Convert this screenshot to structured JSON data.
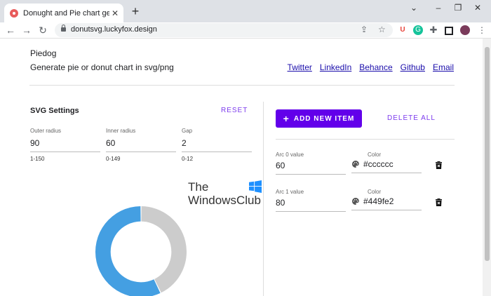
{
  "browser": {
    "tab_title": "Donught and Pie chart generator",
    "tab_close": "✕",
    "new_tab": "+",
    "url": "donutsvg.luckyfox.design",
    "window_controls": [
      "⌄",
      "–",
      "❐",
      "✕"
    ]
  },
  "header": {
    "brand": "Piedog",
    "tagline": "Generate pie or donut chart in svg/png",
    "links": [
      "Twitter",
      "LinkedIn",
      "Behance",
      "Github",
      "Email"
    ]
  },
  "settings": {
    "title": "SVG Settings",
    "reset_label": "RESET",
    "fields": [
      {
        "label": "Outer radius",
        "value": "90",
        "hint": "1-150"
      },
      {
        "label": "Inner radius",
        "value": "60",
        "hint": "0-149"
      },
      {
        "label": "Gap",
        "value": "2",
        "hint": "0-12"
      }
    ]
  },
  "items": {
    "add_label": "ADD NEW ITEM",
    "delete_all_label": "DELETE ALL",
    "arcs": [
      {
        "value_label": "Arc 0 value",
        "value": "60",
        "color_label": "Color",
        "color": "#cccccc"
      },
      {
        "value_label": "Arc 1 value",
        "value": "80",
        "color_label": "Color",
        "color": "#449fe2"
      }
    ]
  },
  "watermark": {
    "line1": "The",
    "line2": "WindowsClub"
  },
  "colors": {
    "accent": "#6200ea",
    "link": "#1a0dab",
    "arc0": "#cccccc",
    "arc1": "#449fe2"
  },
  "chart_data": {
    "type": "pie",
    "categories": [
      "Arc 0",
      "Arc 1"
    ],
    "values": [
      60,
      80
    ],
    "colors": [
      "#cccccc",
      "#449fe2"
    ],
    "outer_radius": 90,
    "inner_radius": 60,
    "gap": 2
  }
}
